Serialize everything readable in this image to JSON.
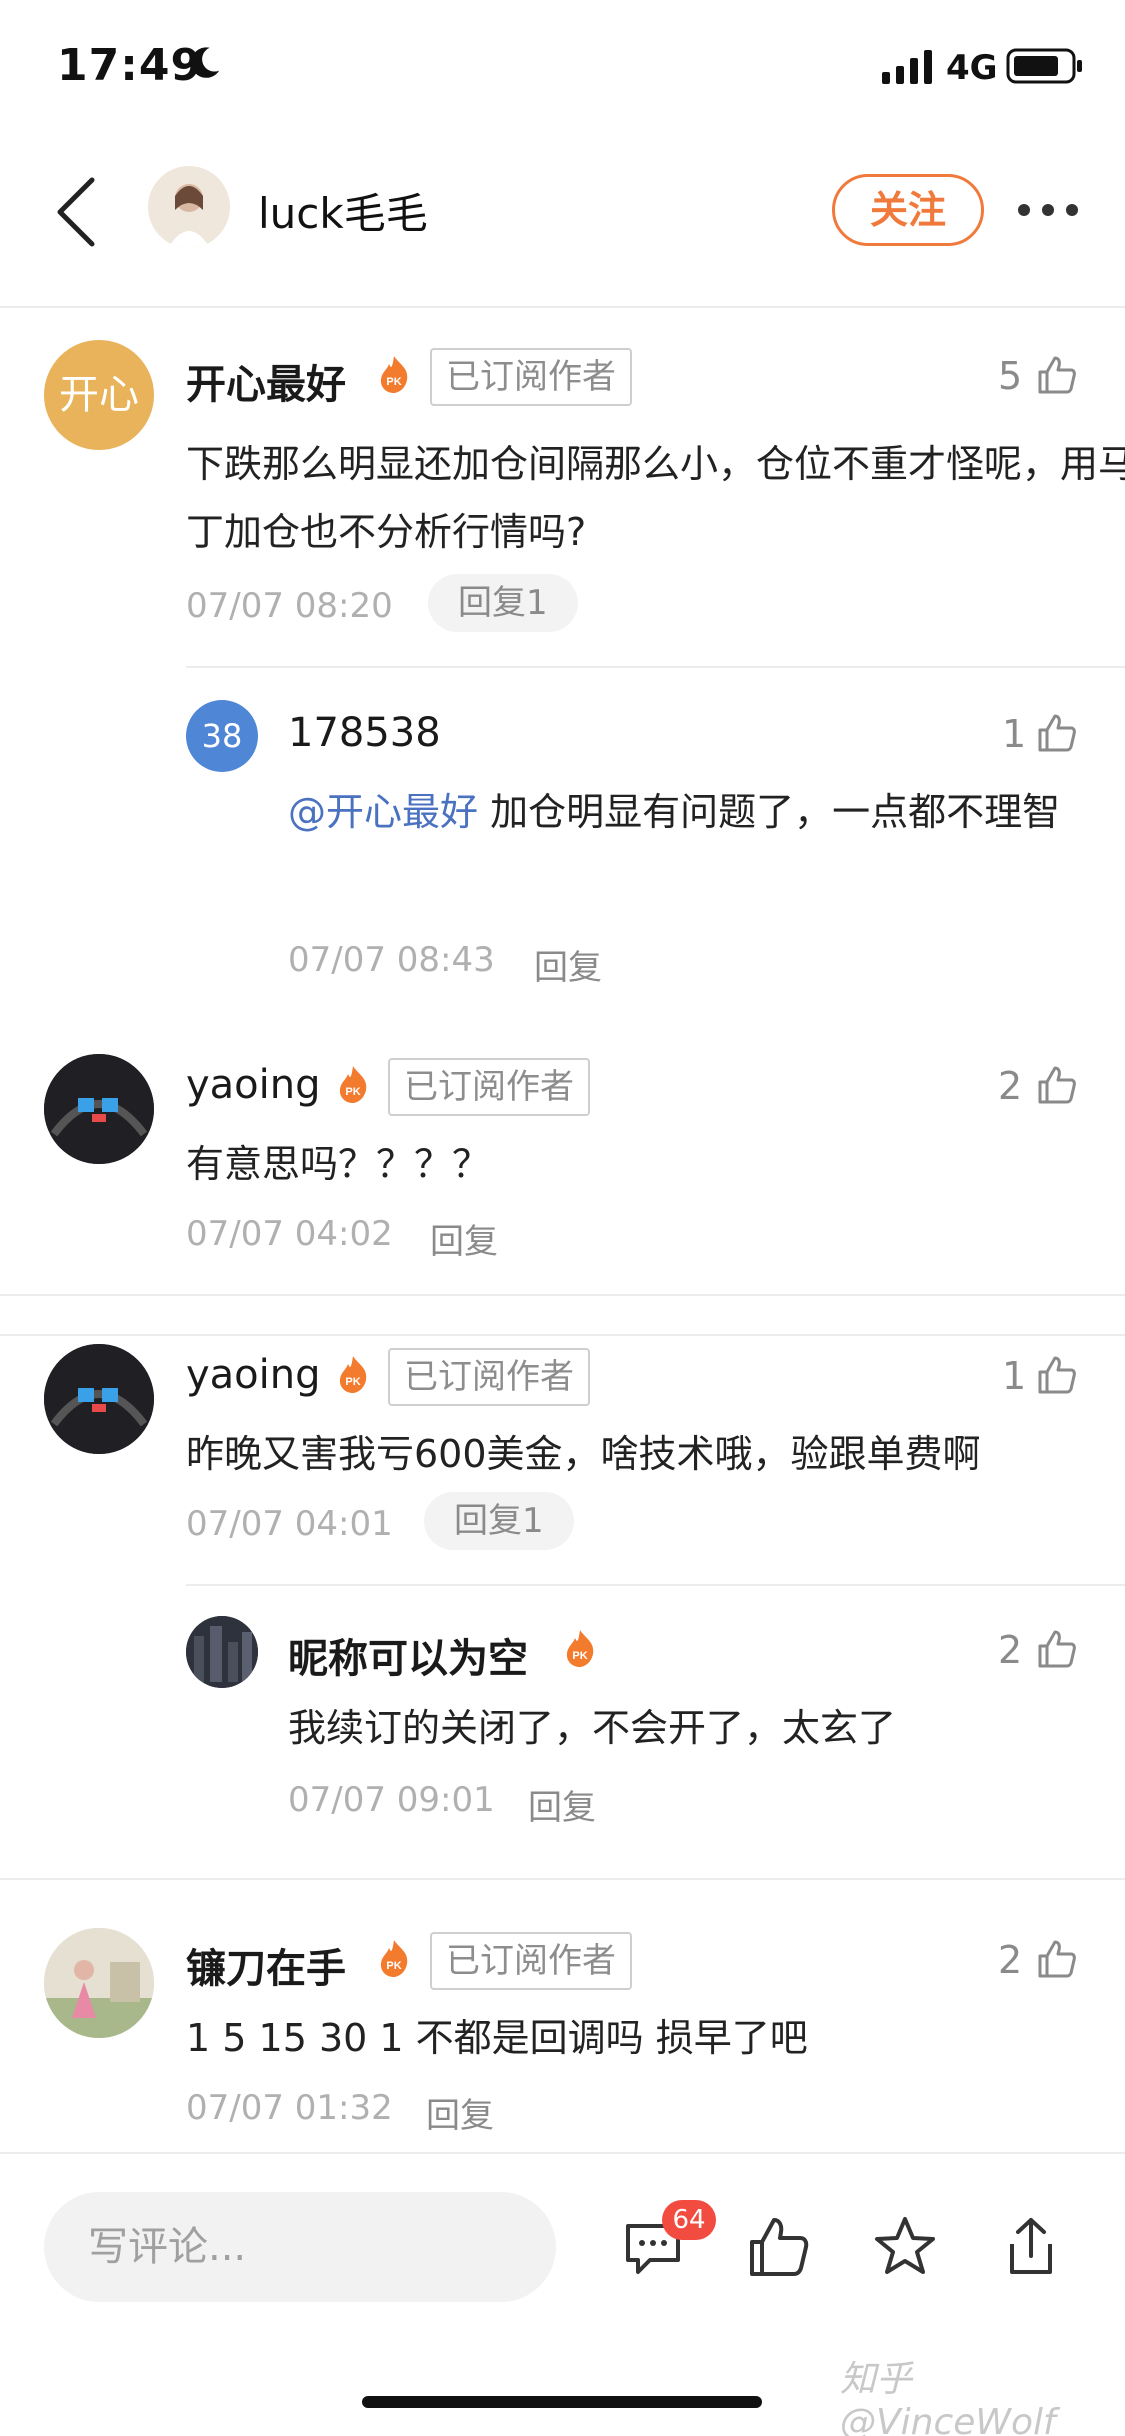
{
  "status": {
    "time": "17:49",
    "network": "4G"
  },
  "header": {
    "user": "luck毛毛",
    "follow_label": "关注"
  },
  "comments": [
    {
      "name": "开心最好",
      "avatar_text": "开心",
      "avatar_color": "#e8b35a",
      "badge": "已订阅作者",
      "likes": "5",
      "text": "下跌那么明显还加仓间隔那么小，仓位不重才怪呢，用马丁加仓也不分析行情吗?",
      "time": "07/07 08:20",
      "reply": "回复1"
    },
    {
      "name": "178538",
      "avatar_text": "38",
      "avatar_color": "#4f86d6",
      "likes": "1",
      "mention": "@开心最好",
      "text": " 加仓明显有问题了，一点都不理智",
      "time": "07/07 08:43",
      "reply": "回复"
    },
    {
      "name": "yaoing",
      "badge": "已订阅作者",
      "likes": "2",
      "text": "有意思吗？？？？",
      "time": "07/07 04:02",
      "reply": "回复"
    },
    {
      "name": "yaoing",
      "badge": "已订阅作者",
      "likes": "1",
      "text": "昨晚又害我亏600美金，啥技术哦，验跟单费啊",
      "time": "07/07 04:01",
      "reply": "回复1"
    },
    {
      "name": "昵称可以为空",
      "likes": "2",
      "text": "我续订的关闭了，不会开了，太玄了",
      "time": "07/07 09:01",
      "reply": "回复"
    },
    {
      "name": "镰刀在手",
      "badge": "已订阅作者",
      "likes": "2",
      "text": "1 5 15 30 1 不都是回调吗 损早了吧",
      "time": "07/07 01:32",
      "reply": "回复"
    }
  ],
  "bottom": {
    "placeholder": "写评论...",
    "comment_count": "64",
    "watermark": "知乎 @VinceWolf"
  },
  "colors": {
    "accent": "#f07a3c",
    "mention": "#4a72c0",
    "badge_red": "#f24b3f"
  }
}
